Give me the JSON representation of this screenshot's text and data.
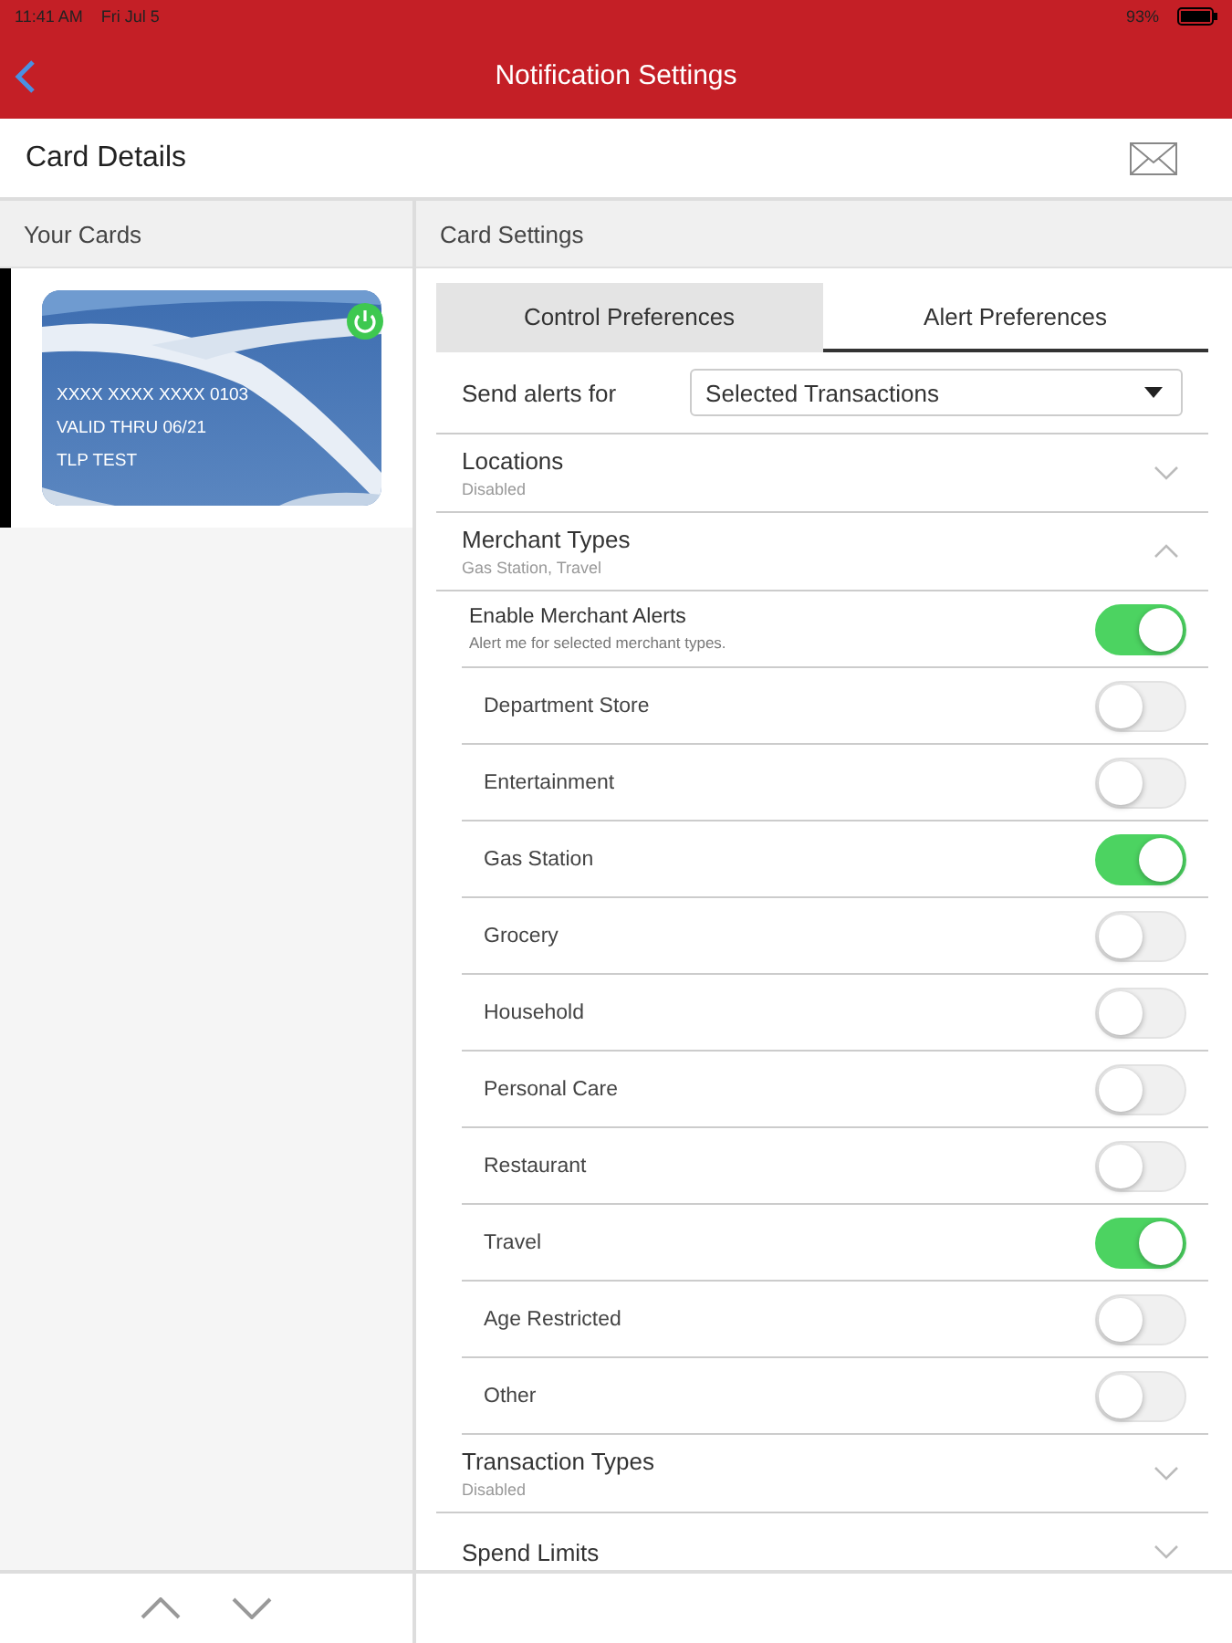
{
  "status_bar": {
    "time": "11:41 AM",
    "date": "Fri Jul 5",
    "battery": "93%"
  },
  "nav": {
    "title": "Notification Settings"
  },
  "header": {
    "title": "Card Details"
  },
  "left": {
    "title": "Your Cards",
    "cards": [
      {
        "number": "XXXX XXXX XXXX 0103",
        "valid": "VALID THRU 06/21",
        "name": "TLP TEST",
        "selected": true,
        "on": true
      }
    ]
  },
  "right": {
    "title": "Card Settings",
    "tabs": [
      {
        "label": "Control Preferences",
        "selected": false
      },
      {
        "label": "Alert Preferences",
        "selected": true
      }
    ],
    "send_alerts": {
      "label": "Send alerts for",
      "value": "Selected Transactions"
    },
    "sections": [
      {
        "title": "Locations",
        "subtitle": "Disabled",
        "expanded": false
      },
      {
        "title": "Merchant Types",
        "subtitle": "Gas Station, Travel",
        "expanded": true,
        "master": {
          "label": "Enable Merchant Alerts",
          "hint": "Alert me for selected merchant types.",
          "on": true
        },
        "items": [
          {
            "label": "Department Store",
            "on": false
          },
          {
            "label": "Entertainment",
            "on": false
          },
          {
            "label": "Gas Station",
            "on": true
          },
          {
            "label": "Grocery",
            "on": false
          },
          {
            "label": "Household",
            "on": false
          },
          {
            "label": "Personal Care",
            "on": false
          },
          {
            "label": "Restaurant",
            "on": false
          },
          {
            "label": "Travel",
            "on": true
          },
          {
            "label": "Age Restricted",
            "on": false
          },
          {
            "label": "Other",
            "on": false
          }
        ]
      },
      {
        "title": "Transaction Types",
        "subtitle": "Disabled",
        "expanded": false
      },
      {
        "title": "Spend Limits",
        "expanded": false
      }
    ]
  }
}
